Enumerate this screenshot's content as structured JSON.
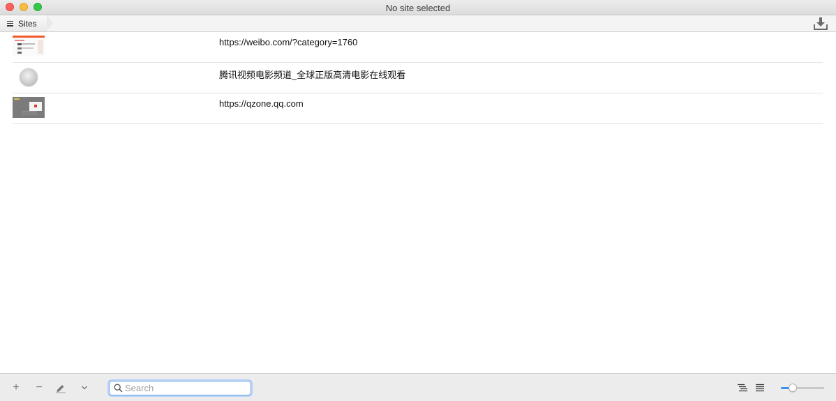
{
  "window": {
    "title": "No site selected"
  },
  "pathbar": {
    "crumb_label": "Sites",
    "download_icon": "download-icon"
  },
  "sites": [
    {
      "label": "https://weibo.com/?category=1760",
      "thumb": "weibo-thumbnail"
    },
    {
      "label": "腾讯视频电影频道_全球正版高清电影在线观看",
      "thumb": "tencent-video-thumbnail"
    },
    {
      "label": "https://qzone.qq.com",
      "thumb": "qzone-thumbnail"
    }
  ],
  "toolbar": {
    "add_label": "+",
    "remove_label": "−",
    "search_placeholder": "Search",
    "search_value": ""
  },
  "zoom": {
    "value": 0.28
  },
  "colors": {
    "accent": "#3b8ef4",
    "close": "#fc605c",
    "minimize": "#fdbc40",
    "zoom": "#34c84a"
  }
}
